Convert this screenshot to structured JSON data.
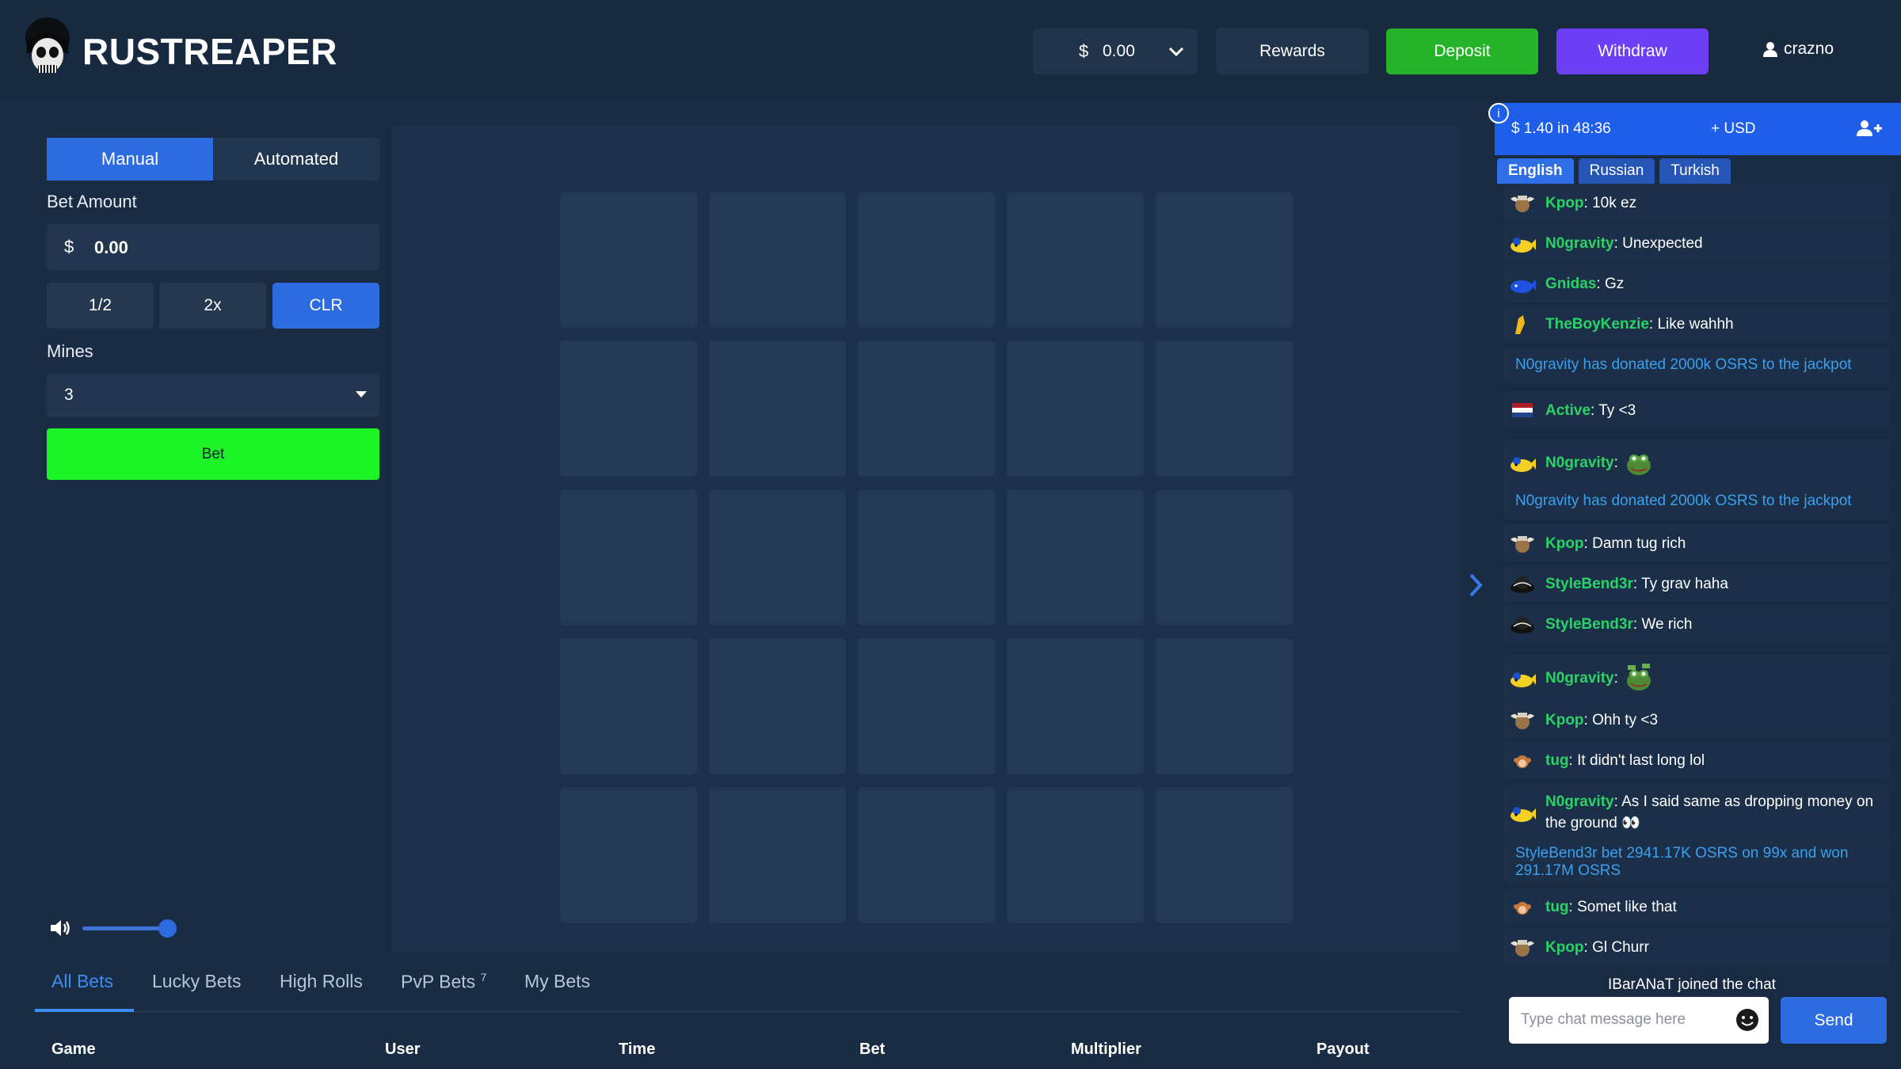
{
  "header": {
    "brand": "RUSTREAPER",
    "balance_currency": "$",
    "balance_value": "0.00",
    "rewards_label": "Rewards",
    "deposit_label": "Deposit",
    "withdraw_label": "Withdraw",
    "username": "crazno",
    "colors": {
      "deposit": "#25b32a",
      "withdraw": "#6a3ff6"
    }
  },
  "game": {
    "tabs": [
      "Manual",
      "Automated"
    ],
    "active_tab": "Manual",
    "bet_amount_label": "Bet Amount",
    "bet_currency": "$",
    "bet_value": "0.00",
    "quick_buttons": [
      "1/2",
      "2x",
      "CLR"
    ],
    "mines_label": "Mines",
    "mines_value": "3",
    "bet_button": "Bet",
    "grid_rows": 5,
    "grid_cols": 5,
    "volume_level": 0.85,
    "colors": {
      "bet_button": "#1df425",
      "accent": "#2c6ce0"
    }
  },
  "bets": {
    "tabs": [
      "All Bets",
      "Lucky Bets",
      "High Rolls",
      "PvP Bets",
      "My Bets"
    ],
    "pvp_count": "7",
    "active_tab": "All Bets",
    "columns": [
      "Game",
      "User",
      "Time",
      "Bet",
      "Multiplier",
      "Payout"
    ]
  },
  "chat": {
    "info_icon": "i",
    "jackpot": "$ 1.40 in 48:36",
    "currency": "+ USD",
    "languages": [
      "English",
      "Russian",
      "Turkish"
    ],
    "active_language": "English",
    "messages": [
      {
        "type": "user",
        "avatar": "winged-helmet",
        "name": "Kpop",
        "text": "10k ez"
      },
      {
        "type": "user",
        "avatar": "yellow-whale",
        "name": "N0gravity",
        "text": "Unexpected"
      },
      {
        "type": "user",
        "avatar": "blue-whale",
        "name": "Gnidas",
        "text": "Gz"
      },
      {
        "type": "user",
        "avatar": "gold-figure",
        "name": "TheBoyKenzie",
        "text": "Like wahhh"
      },
      {
        "type": "system",
        "text": "N0gravity has donated 2000k OSRS to the jackpot"
      },
      {
        "type": "user",
        "avatar": "netherlands-flag",
        "name": "Active",
        "text": "Ty <3"
      },
      {
        "type": "user",
        "avatar": "yellow-whale",
        "name": "N0gravity",
        "text": "",
        "emote": "pepe"
      },
      {
        "type": "system",
        "text": "N0gravity has donated 2000k OSRS to the jackpot"
      },
      {
        "type": "user",
        "avatar": "winged-helmet",
        "name": "Kpop",
        "text": "Damn tug rich"
      },
      {
        "type": "user",
        "avatar": "black-hat",
        "name": "StyleBend3r",
        "text": "Ty grav haha"
      },
      {
        "type": "user",
        "avatar": "black-hat",
        "name": "StyleBend3r",
        "text": "We rich"
      },
      {
        "type": "user",
        "avatar": "yellow-whale",
        "name": "N0gravity",
        "text": "",
        "emote": "pepe-money"
      },
      {
        "type": "user",
        "avatar": "winged-helmet",
        "name": "Kpop",
        "text": "Ohh ty <3"
      },
      {
        "type": "user",
        "avatar": "monkey",
        "name": "tug",
        "text": "It didn't last long lol"
      },
      {
        "type": "user",
        "avatar": "yellow-whale",
        "name": "N0gravity",
        "text": "As I said same as dropping money on the ground 👀"
      },
      {
        "type": "system",
        "text": "StyleBend3r bet 2941.17K OSRS on 99x and won 291.17M OSRS"
      },
      {
        "type": "user",
        "avatar": "monkey",
        "name": "tug",
        "text": "Somet like that"
      },
      {
        "type": "user",
        "avatar": "winged-helmet",
        "name": "Kpop",
        "text": "Gl Churr"
      }
    ],
    "joined_notice": "IBarANaT joined the chat",
    "input_placeholder": "Type chat message here",
    "send_label": "Send"
  }
}
